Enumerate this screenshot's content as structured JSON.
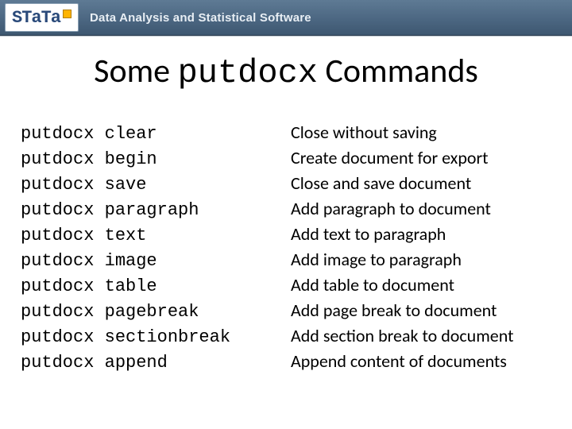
{
  "header": {
    "logo_text": "STaTa",
    "tagline": "Data Analysis and Statistical Software"
  },
  "title": {
    "pre": "Some ",
    "code": "putdocx",
    "post": " Commands"
  },
  "commands": [
    {
      "cmd": "putdocx clear",
      "desc": "Close without saving"
    },
    {
      "cmd": "putdocx begin",
      "desc": "Create document for export"
    },
    {
      "cmd": "putdocx save",
      "desc": "Close and save document"
    },
    {
      "cmd": "putdocx paragraph",
      "desc": "Add paragraph to document"
    },
    {
      "cmd": "putdocx text",
      "desc": "Add text to paragraph"
    },
    {
      "cmd": "putdocx image",
      "desc": "Add image to paragraph"
    },
    {
      "cmd": "putdocx table",
      "desc": "Add table to document"
    },
    {
      "cmd": "putdocx pagebreak",
      "desc": "Add page break to document"
    },
    {
      "cmd": "putdocx sectionbreak",
      "desc": "Add section break to document"
    },
    {
      "cmd": "putdocx append",
      "desc": "Append content of documents"
    }
  ]
}
